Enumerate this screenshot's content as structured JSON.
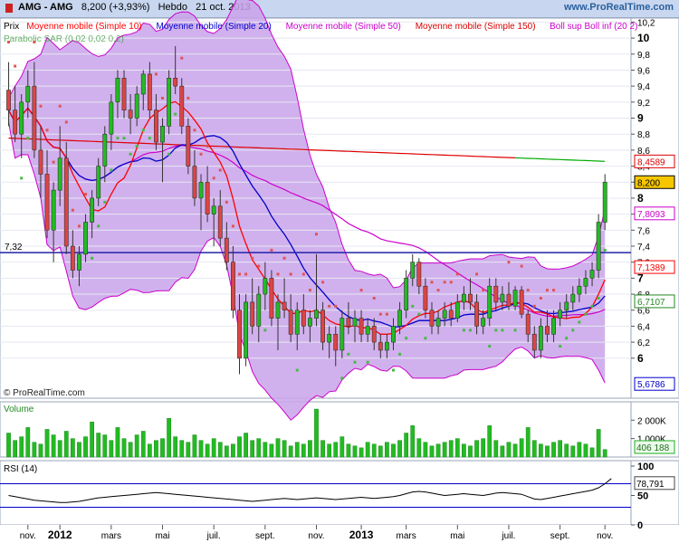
{
  "header": {
    "title": "AMG - AMG",
    "price_change": "8,200 (+3,93%)",
    "period": "Hebdo",
    "date": "21 oct. 2013",
    "logo": "www.ProRealTime.com"
  },
  "legend": {
    "prix": "Prix",
    "mm10": "Moyenne mobile (Simple 10)",
    "mm20": "Moyenne mobile (Simple 20)",
    "mm50": "Moyenne mobile (Simple 50)",
    "mm150": "Moyenne mobile (Simple 150)",
    "boll": "Boll sup Boll inf (20 2)",
    "sar": "Parabolic SAR (0,02 0,02 0,2)"
  },
  "watermark": "© ProRealTime.com",
  "hline_label": "7,32",
  "colors": {
    "up": "#22bb22",
    "down": "#dd4444",
    "mm10": "#ff0000",
    "mm20": "#0000cc",
    "mm50": "#cc00cc",
    "mm150": "#dd0000",
    "mm150_late": "#00aa00",
    "boll_fill": "#c9a3ea",
    "sar": "#44bb44",
    "sar_down": "#dd5555",
    "hline": "#2222aa",
    "volume": "#22bb22",
    "rsi": "#000000"
  },
  "chart_data": [
    {
      "type": "candlestick",
      "title": "AMG - AMG",
      "ylim": [
        5.5,
        10.25
      ],
      "yticks": [
        6,
        6.2,
        6.4,
        6.6,
        6.8,
        7,
        7.2,
        7.4,
        7.6,
        7.8,
        8,
        8.2,
        8.4,
        8.6,
        8.8,
        9,
        9.2,
        9.4,
        9.6,
        9.8,
        10,
        10.2
      ],
      "ytick_labels": [
        "6",
        "6,2",
        "6,4",
        "6,6",
        "6,8",
        "7",
        "7,2",
        "7,4",
        "7,6",
        "7,8",
        "8",
        "8,2",
        "8,4",
        "8,6",
        "8,8",
        "9",
        "9,2",
        "9,4",
        "9,6",
        "9,8",
        "10",
        "10,2"
      ],
      "xticks": [
        "nov.",
        "2012",
        "mars",
        "mai",
        "juil.",
        "sept.",
        "nov.",
        "2013",
        "mars",
        "mai",
        "juil.",
        "sept.",
        "nov."
      ],
      "horizontal_line": 7.32,
      "last_values": {
        "mm150": "8,4589",
        "price": "8,200",
        "boll_sup": "7,8093",
        "mm10": "7,1389",
        "mm20": "6,7107",
        "boll_inf": "5,6786"
      },
      "ohlc": [
        [
          9.35,
          9.7,
          8.9,
          9.1
        ],
        [
          9.1,
          9.4,
          8.7,
          8.8
        ],
        [
          8.8,
          9.3,
          8.5,
          9.2
        ],
        [
          9.2,
          9.6,
          9.0,
          9.4
        ],
        [
          9.4,
          9.7,
          8.5,
          8.6
        ],
        [
          8.6,
          8.9,
          8.0,
          8.3
        ],
        [
          8.3,
          8.6,
          7.5,
          7.6
        ],
        [
          7.6,
          8.2,
          7.2,
          8.1
        ],
        [
          8.1,
          8.9,
          7.9,
          8.5
        ],
        [
          8.5,
          8.7,
          7.3,
          7.4
        ],
        [
          7.4,
          7.6,
          7.0,
          7.1
        ],
        [
          7.1,
          7.4,
          6.9,
          7.3
        ],
        [
          7.3,
          7.8,
          7.2,
          7.7
        ],
        [
          7.7,
          8.1,
          7.5,
          8.0
        ],
        [
          8.0,
          8.5,
          7.9,
          8.4
        ],
        [
          8.4,
          8.9,
          8.2,
          8.8
        ],
        [
          8.8,
          9.3,
          8.6,
          9.2
        ],
        [
          9.2,
          9.6,
          9.0,
          9.5
        ],
        [
          9.5,
          9.6,
          9.0,
          9.1
        ],
        [
          9.1,
          9.3,
          8.8,
          9.0
        ],
        [
          9.0,
          9.4,
          8.9,
          9.3
        ],
        [
          9.3,
          9.6,
          9.1,
          9.55
        ],
        [
          9.55,
          9.7,
          9.0,
          9.1
        ],
        [
          9.1,
          9.3,
          8.6,
          8.7
        ],
        [
          8.7,
          9.0,
          8.2,
          8.9
        ],
        [
          8.9,
          9.6,
          8.8,
          9.5
        ],
        [
          9.5,
          9.9,
          9.3,
          9.4
        ],
        [
          9.4,
          9.5,
          8.8,
          8.9
        ],
        [
          8.9,
          9.0,
          8.3,
          8.4
        ],
        [
          8.4,
          8.6,
          7.9,
          8.0
        ],
        [
          8.0,
          8.3,
          7.6,
          8.2
        ],
        [
          8.2,
          8.4,
          7.7,
          7.8
        ],
        [
          7.8,
          8.0,
          7.4,
          7.9
        ],
        [
          7.9,
          8.1,
          7.4,
          7.5
        ],
        [
          7.5,
          7.7,
          7.1,
          7.2
        ],
        [
          7.2,
          7.4,
          6.5,
          6.6
        ],
        [
          6.6,
          6.8,
          5.8,
          6.0
        ],
        [
          6.0,
          6.8,
          5.9,
          6.7
        ],
        [
          6.7,
          7.0,
          6.3,
          6.4
        ],
        [
          6.4,
          6.9,
          6.2,
          6.8
        ],
        [
          6.8,
          7.2,
          6.6,
          7.0
        ],
        [
          7.0,
          7.1,
          6.4,
          6.5
        ],
        [
          6.5,
          6.8,
          6.1,
          6.7
        ],
        [
          6.7,
          7.0,
          6.5,
          6.6
        ],
        [
          6.6,
          6.8,
          6.2,
          6.3
        ],
        [
          6.3,
          6.7,
          6.1,
          6.6
        ],
        [
          6.6,
          6.8,
          6.3,
          6.4
        ],
        [
          6.4,
          6.6,
          6.2,
          6.5
        ],
        [
          6.5,
          7.3,
          6.4,
          6.6
        ],
        [
          6.6,
          6.7,
          6.1,
          6.2
        ],
        [
          6.2,
          6.4,
          6.0,
          6.3
        ],
        [
          6.3,
          6.4,
          5.9,
          6.1
        ],
        [
          6.1,
          6.6,
          6.0,
          6.5
        ],
        [
          6.5,
          6.7,
          6.3,
          6.4
        ],
        [
          6.4,
          6.6,
          6.2,
          6.5
        ],
        [
          6.5,
          6.6,
          6.2,
          6.3
        ],
        [
          6.3,
          6.5,
          6.2,
          6.4
        ],
        [
          6.4,
          6.5,
          6.1,
          6.2
        ],
        [
          6.2,
          6.3,
          6.0,
          6.1
        ],
        [
          6.1,
          6.3,
          6.0,
          6.2
        ],
        [
          6.2,
          6.5,
          6.1,
          6.4
        ],
        [
          6.4,
          6.7,
          6.3,
          6.6
        ],
        [
          6.6,
          7.1,
          6.5,
          7.0
        ],
        [
          7.0,
          7.3,
          6.9,
          7.2
        ],
        [
          7.2,
          7.25,
          6.8,
          6.9
        ],
        [
          6.9,
          7.0,
          6.5,
          6.6
        ],
        [
          6.6,
          6.7,
          6.3,
          6.4
        ],
        [
          6.4,
          6.6,
          6.3,
          6.5
        ],
        [
          6.5,
          6.7,
          6.4,
          6.6
        ],
        [
          6.6,
          6.7,
          6.4,
          6.5
        ],
        [
          6.5,
          6.8,
          6.45,
          6.7
        ],
        [
          6.7,
          6.9,
          6.6,
          6.8
        ],
        [
          6.8,
          7.0,
          6.6,
          6.7
        ],
        [
          6.7,
          6.8,
          6.3,
          6.4
        ],
        [
          6.4,
          6.6,
          6.3,
          6.5
        ],
        [
          6.5,
          7.0,
          6.4,
          6.9
        ],
        [
          6.9,
          7.0,
          6.6,
          6.7
        ],
        [
          6.7,
          6.9,
          6.6,
          6.8
        ],
        [
          6.8,
          6.95,
          6.6,
          6.65
        ],
        [
          6.65,
          6.9,
          6.6,
          6.85
        ],
        [
          6.85,
          6.9,
          6.5,
          6.55
        ],
        [
          6.55,
          6.6,
          6.2,
          6.3
        ],
        [
          6.3,
          6.4,
          6.0,
          6.1
        ],
        [
          6.1,
          6.5,
          6.0,
          6.4
        ],
        [
          6.4,
          6.6,
          6.2,
          6.3
        ],
        [
          6.3,
          6.6,
          6.2,
          6.5
        ],
        [
          6.5,
          6.7,
          6.4,
          6.6
        ],
        [
          6.6,
          6.8,
          6.5,
          6.7
        ],
        [
          6.7,
          6.9,
          6.6,
          6.8
        ],
        [
          6.8,
          7.0,
          6.7,
          6.9
        ],
        [
          6.9,
          7.1,
          6.8,
          7.0
        ],
        [
          7.0,
          7.2,
          6.9,
          7.1
        ],
        [
          7.1,
          7.8,
          7.0,
          7.7
        ],
        [
          7.7,
          8.3,
          7.6,
          8.2
        ]
      ],
      "series": [
        {
          "name": "Moyenne mobile (Simple 10)",
          "last": 7.1389
        },
        {
          "name": "Moyenne mobile (Simple 20)",
          "last": 6.7107
        },
        {
          "name": "Moyenne mobile (Simple 50)"
        },
        {
          "name": "Moyenne mobile (Simple 150)",
          "last": 8.4589
        },
        {
          "name": "Boll sup Boll inf (20 2)",
          "last_sup": 7.8093,
          "last_inf": 5.6786
        },
        {
          "name": "Parabolic SAR (0,02 0,02 0,2)"
        }
      ]
    },
    {
      "type": "bar",
      "title": "Volume",
      "ylim": [
        0,
        2700000
      ],
      "yticks": [
        1000000,
        2000000
      ],
      "ytick_labels": [
        "1 000K",
        "2 000K"
      ],
      "last_value_label": "406 188",
      "values": [
        1300000,
        900000,
        1100000,
        1600000,
        800000,
        700000,
        1500000,
        1200000,
        900000,
        1400000,
        1000000,
        800000,
        1100000,
        1900000,
        1300000,
        1200000,
        900000,
        1600000,
        1000000,
        800000,
        1200000,
        1400000,
        700000,
        900000,
        1000000,
        2100000,
        1100000,
        900000,
        800000,
        1200000,
        900000,
        700000,
        1000000,
        800000,
        600000,
        700000,
        1100000,
        1300000,
        900000,
        1000000,
        800000,
        700000,
        1000000,
        900000,
        600000,
        800000,
        700000,
        900000,
        2600000,
        900000,
        700000,
        800000,
        1100000,
        700000,
        600000,
        500000,
        800000,
        700000,
        600000,
        800000,
        700000,
        900000,
        1300000,
        1700000,
        1000000,
        800000,
        600000,
        700000,
        800000,
        900000,
        1000000,
        700000,
        600000,
        900000,
        1000000,
        1700000,
        900000,
        600000,
        800000,
        700000,
        1000000,
        1600000,
        900000,
        700000,
        600000,
        800000,
        900000,
        700000,
        600000,
        800000,
        700000,
        500000,
        1500000,
        406188
      ]
    },
    {
      "type": "line",
      "title": "RSI (14)",
      "ylim": [
        0,
        100
      ],
      "yticks": [
        0,
        50,
        100
      ],
      "ytick_labels": [
        "0",
        "50",
        "100"
      ],
      "reference_lines": [
        30,
        70
      ],
      "last_value_label": "78,791",
      "values": [
        50,
        48,
        46,
        44,
        42,
        41,
        40,
        39,
        38,
        38,
        39,
        40,
        42,
        44,
        46,
        47,
        48,
        49,
        50,
        51,
        52,
        53,
        54,
        55,
        54,
        53,
        52,
        51,
        50,
        49,
        48,
        47,
        46,
        45,
        44,
        43,
        42,
        41,
        40,
        41,
        42,
        43,
        44,
        45,
        44,
        43,
        44,
        45,
        46,
        45,
        44,
        43,
        44,
        45,
        46,
        47,
        46,
        45,
        46,
        47,
        48,
        50,
        53,
        56,
        57,
        56,
        54,
        52,
        50,
        51,
        52,
        53,
        52,
        51,
        50,
        52,
        54,
        55,
        54,
        53,
        52,
        48,
        44,
        43,
        45,
        47,
        49,
        51,
        53,
        55,
        57,
        59,
        63,
        70,
        78.791
      ]
    }
  ]
}
